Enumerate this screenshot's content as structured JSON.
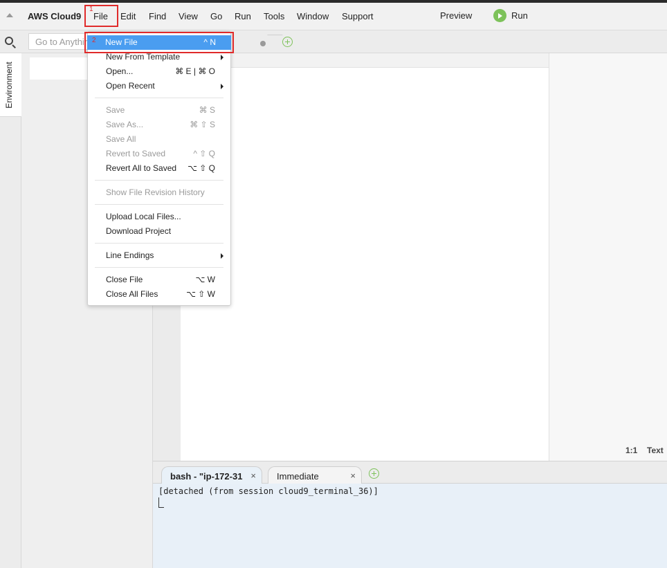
{
  "menubar": {
    "brand": "AWS Cloud9",
    "items": [
      "File",
      "Edit",
      "Find",
      "View",
      "Go",
      "Run",
      "Tools",
      "Window",
      "Support"
    ],
    "preview": "Preview",
    "run": "Run"
  },
  "search": {
    "placeholder": "Go to Anything (⌘ P)"
  },
  "sidebar": {
    "environment_tab": "Environment"
  },
  "file_menu": {
    "items": [
      {
        "label": "New File",
        "shortcut": "^ N",
        "highlighted": true
      },
      {
        "label": "New From Template",
        "submenu": true
      },
      {
        "label": "Open...",
        "shortcut": "⌘ E | ⌘ O"
      },
      {
        "label": "Open Recent",
        "submenu": true
      },
      {
        "label": "Save",
        "shortcut": "⌘ S",
        "disabled": true
      },
      {
        "label": "Save As...",
        "shortcut": "⌘ ⇧ S",
        "disabled": true
      },
      {
        "label": "Save All",
        "disabled": true
      },
      {
        "label": "Revert to Saved",
        "shortcut": "^ ⇧ Q",
        "disabled": true
      },
      {
        "label": "Revert All to Saved",
        "shortcut": "⌥ ⇧ Q"
      },
      {
        "label": "Show File Revision History",
        "disabled": true
      },
      {
        "label": "Upload Local Files..."
      },
      {
        "label": "Download Project"
      },
      {
        "label": "Line Endings",
        "submenu": true
      },
      {
        "label": "Close File",
        "shortcut": "⌥ W"
      },
      {
        "label": "Close All Files",
        "shortcut": "⌥ ⇧ W"
      }
    ]
  },
  "editor_status": {
    "position": "1:1",
    "mode": "Text"
  },
  "terminal": {
    "tabs": [
      {
        "label": "bash - \"ip-172-31",
        "close": "×"
      },
      {
        "label": "Immediate",
        "close": "×"
      }
    ],
    "output": "[detached (from session cloud9_terminal_36)]"
  },
  "annotations": {
    "step1": "1",
    "step2": "2"
  },
  "colors": {
    "highlight": "#4a9df0",
    "annotation": "#e02a2a",
    "run_green": "#7dc25a"
  }
}
